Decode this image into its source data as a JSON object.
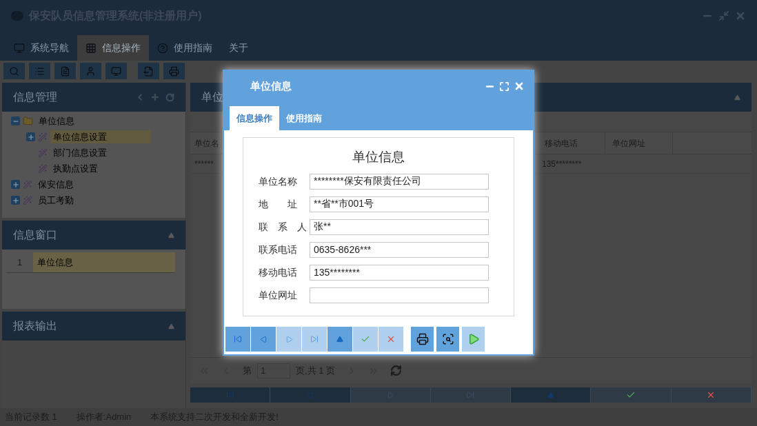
{
  "window": {
    "title": "保安队员信息管理系统(非注册用户)"
  },
  "tabs": [
    {
      "label": "系统导航",
      "selected": false,
      "kind": "monitor"
    },
    {
      "label": "信息操作",
      "selected": true,
      "kind": "grid"
    },
    {
      "label": "使用指南",
      "selected": false,
      "kind": "help"
    },
    {
      "label": "关于",
      "selected": false,
      "kind": "none"
    }
  ],
  "left_panels": [
    {
      "kind": "tree",
      "title": "信息管理",
      "tree": [
        {
          "label": "单位信息",
          "expanded": true,
          "selected": false,
          "children": [
            {
              "label": "单位信息设置",
              "expanded": false,
              "selected": true
            },
            {
              "label": "部门信息设置",
              "selected": false
            },
            {
              "label": "执勤点设置",
              "selected": false
            }
          ]
        },
        {
          "label": "保安信息",
          "expanded": false,
          "selected": false
        },
        {
          "label": "员工考勤",
          "expanded": false,
          "selected": false
        }
      ]
    },
    {
      "kind": "list",
      "title": "信息窗口",
      "items": [
        {
          "index": "1",
          "label": "单位信息",
          "selected": true
        }
      ]
    },
    {
      "kind": "empty",
      "title": "报表输出"
    }
  ],
  "main_panel": {
    "title": "单位",
    "table": {
      "columns": [
        "单位名",
        "移动电话",
        "单位网址"
      ],
      "rows": [
        [
          "******",
          "135********"
        ]
      ]
    },
    "pager": {
      "page_label": "第",
      "page": "1",
      "total": "页,共 1 页"
    },
    "nav": [
      {
        "kind": "first",
        "disabled": false
      },
      {
        "kind": "prev",
        "disabled": false
      },
      {
        "kind": "next",
        "disabled": true
      },
      {
        "kind": "last",
        "disabled": true
      },
      {
        "kind": "up",
        "disabled": false
      },
      {
        "kind": "ok",
        "disabled": true
      },
      {
        "kind": "cancel",
        "disabled": true
      }
    ]
  },
  "dialog": {
    "title": "单位信息",
    "tabs": [
      {
        "label": "信息操作",
        "selected": true
      },
      {
        "label": "使用指南",
        "selected": false
      }
    ],
    "form_title": "单位信息",
    "fields": [
      {
        "label": "单位名称",
        "value": "********保安有限责任公司"
      },
      {
        "label": "地　　址",
        "value": "**省**市001号"
      },
      {
        "label": "联　系　人",
        "value": "张**"
      },
      {
        "label": "联系电话",
        "value": "0635-8626***"
      },
      {
        "label": "移动电话",
        "value": "135********"
      },
      {
        "label": "单位网址"
      }
    ],
    "nav": [
      {
        "kind": "first",
        "disabled": false
      },
      {
        "kind": "prev",
        "disabled": false
      },
      {
        "kind": "next",
        "disabled": true
      },
      {
        "kind": "last",
        "disabled": true
      },
      {
        "kind": "up",
        "disabled": false
      },
      {
        "kind": "ok",
        "disabled": true
      },
      {
        "kind": "cancel",
        "disabled": true
      }
    ],
    "actions": [
      {
        "kind": "print",
        "disabled": false
      },
      {
        "kind": "preview",
        "disabled": false
      },
      {
        "kind": "run",
        "disabled": true
      }
    ]
  },
  "status_bar": [
    "当前记录数 1",
    "操作者:Admin",
    "本系统支持二次开发和全新开发!"
  ]
}
